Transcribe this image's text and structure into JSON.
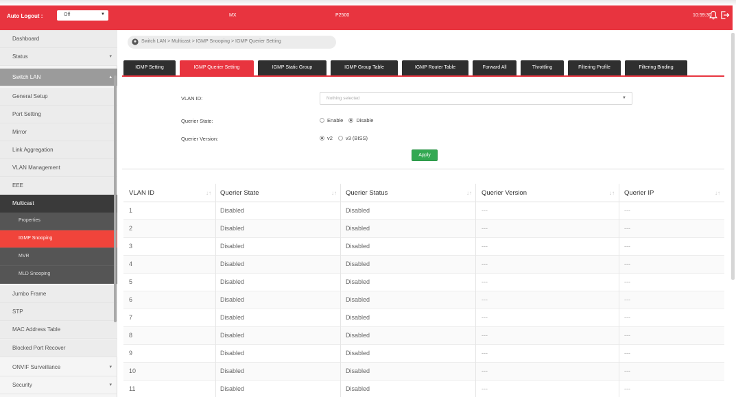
{
  "header": {
    "auto_logout_label": "Auto Logout :",
    "auto_logout_value": "Off",
    "model": "MX",
    "device_name": "P2500",
    "clock": "10:59:30",
    "accent_color": "#e8343f"
  },
  "sidebar": {
    "items": [
      {
        "label": "Dashboard",
        "style": "gray",
        "arrow": ""
      },
      {
        "label": "Status",
        "style": "gray",
        "arrow": "▾"
      },
      {
        "label": "Switch LAN",
        "style": "section-open",
        "arrow": "▴"
      },
      {
        "label": "General Setup",
        "style": "gray",
        "arrow": ""
      },
      {
        "label": "Port Setting",
        "style": "gray",
        "arrow": ""
      },
      {
        "label": "Mirror",
        "style": "gray",
        "arrow": ""
      },
      {
        "label": "Link Aggregation",
        "style": "gray",
        "arrow": ""
      },
      {
        "label": "VLAN Management",
        "style": "gray",
        "arrow": ""
      },
      {
        "label": "EEE",
        "style": "gray",
        "arrow": ""
      },
      {
        "label": "Multicast",
        "style": "dark",
        "arrow": ""
      },
      {
        "label": "Properties",
        "style": "sub",
        "arrow": ""
      },
      {
        "label": "IGMP Snooping",
        "style": "sub active",
        "arrow": ""
      },
      {
        "label": "MVR",
        "style": "sub",
        "arrow": ""
      },
      {
        "label": "MLD Snooping",
        "style": "sub",
        "arrow": ""
      },
      {
        "label": "Jumbo Frame",
        "style": "gray",
        "arrow": ""
      },
      {
        "label": "STP",
        "style": "gray",
        "arrow": ""
      },
      {
        "label": "MAC Address Table",
        "style": "gray",
        "arrow": ""
      },
      {
        "label": "Blocked Port Recover",
        "style": "gray",
        "arrow": ""
      },
      {
        "label": "ONVIF Surveillance",
        "style": "",
        "arrow": "▾"
      },
      {
        "label": "Security",
        "style": "",
        "arrow": "▾"
      }
    ]
  },
  "breadcrumb": "Switch LAN > Multicast > IGMP Snooping > IGMP Querier Setting",
  "tabs": [
    {
      "label": "IGMP Setting",
      "active": false
    },
    {
      "label": "IGMP Querier Setting",
      "active": true
    },
    {
      "label": "IGMP Static Group",
      "active": false
    },
    {
      "label": "IGMP Group Table",
      "active": false
    },
    {
      "label": "IGMP Router Table",
      "active": false
    },
    {
      "label": "Forward All",
      "active": false
    },
    {
      "label": "Throttling",
      "active": false
    },
    {
      "label": "Filtering Profile",
      "active": false
    },
    {
      "label": "Filtering Binding",
      "active": false
    }
  ],
  "form": {
    "vlan_id_label": "VLAN ID:",
    "vlan_id_placeholder": "Nothing selected",
    "querier_state_label": "Querier State:",
    "querier_state_options": [
      "Enable",
      "Disable"
    ],
    "querier_state_selected": "Disable",
    "querier_version_label": "Querier Version:",
    "querier_version_options": [
      "v2",
      "v3 (BISS)"
    ],
    "querier_version_selected": "v2",
    "apply_label": "Apply"
  },
  "table": {
    "columns": [
      "VLAN ID",
      "Querier State",
      "Querier Status",
      "Querier Version",
      "Querier IP"
    ],
    "sort_glyph": "↓↑",
    "rows": [
      [
        "1",
        "Disabled",
        "Disabled",
        "---",
        "---"
      ],
      [
        "2",
        "Disabled",
        "Disabled",
        "---",
        "---"
      ],
      [
        "3",
        "Disabled",
        "Disabled",
        "---",
        "---"
      ],
      [
        "4",
        "Disabled",
        "Disabled",
        "---",
        "---"
      ],
      [
        "5",
        "Disabled",
        "Disabled",
        "---",
        "---"
      ],
      [
        "6",
        "Disabled",
        "Disabled",
        "---",
        "---"
      ],
      [
        "7",
        "Disabled",
        "Disabled",
        "---",
        "---"
      ],
      [
        "8",
        "Disabled",
        "Disabled",
        "---",
        "---"
      ],
      [
        "9",
        "Disabled",
        "Disabled",
        "---",
        "---"
      ],
      [
        "10",
        "Disabled",
        "Disabled",
        "---",
        "---"
      ],
      [
        "11",
        "Disabled",
        "Disabled",
        "---",
        "---"
      ]
    ]
  },
  "icons": {
    "bell": "bell-icon",
    "logout": "logout-icon",
    "location": "location-pin-icon",
    "dropdown": "chevron-down-icon"
  }
}
